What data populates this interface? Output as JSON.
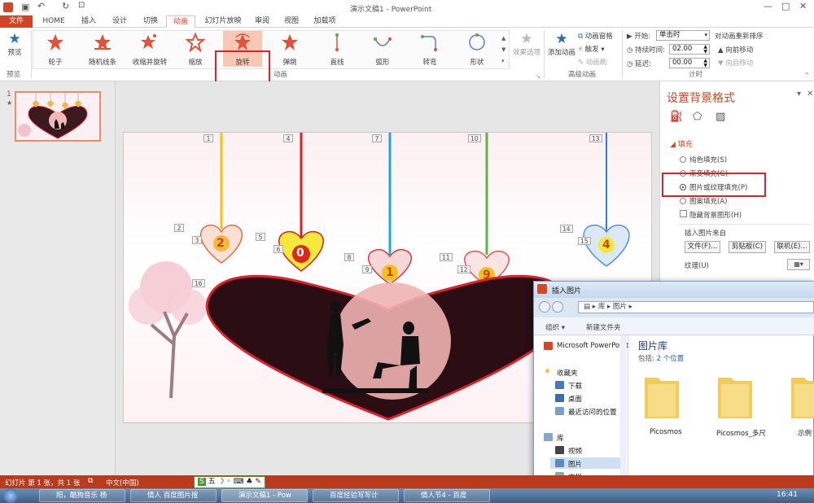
{
  "window_title": "演示文稿1 - PowerPoint",
  "tabs": [
    "文件",
    "HOME",
    "插入",
    "设计",
    "切换",
    "动画",
    "幻灯片放映",
    "审阅",
    "视图",
    "加载项"
  ],
  "ribbon": {
    "preview": {
      "label": "预览",
      "group": "预览"
    },
    "animations": [
      "轮子",
      "随机线条",
      "收缩并旋转",
      "缩放",
      "旋转",
      "弹跳",
      "直线",
      "弧形",
      "转弯",
      "形状"
    ],
    "selected_animation": "旋转",
    "effect_options": "效果选项",
    "group_animation": "动画",
    "add_animation": "添加动画",
    "animation_pane": "动画窗格",
    "trigger": "触发",
    "animation_painter": "动画刷",
    "group_advanced": "高级动画",
    "start_label": "开始:",
    "start_value": "单击时",
    "duration_label": "持续时间:",
    "duration_value": "02.00",
    "delay_label": "延迟:",
    "delay_value": "00.00",
    "reorder_title": "对动画重新排序",
    "move_earlier": "向前移动",
    "move_later": "向后移动",
    "group_timing": "计时"
  },
  "thumbnail": {
    "number": "1",
    "star": "★"
  },
  "slide": {
    "tags": [
      "1",
      "4",
      "7",
      "10",
      "13",
      "2",
      "3",
      "5",
      "6",
      "8",
      "9",
      "11",
      "12",
      "14",
      "15",
      "16"
    ],
    "hearts": [
      "2",
      "0",
      "1",
      "9",
      "4"
    ]
  },
  "format_pane": {
    "title": "设置背景格式",
    "section": "填充",
    "options": [
      "纯色填充(S)",
      "渐变填充(G)",
      "图片或纹理填充(P)",
      "图案填充(A)"
    ],
    "selected": "图片或纹理填充(P)",
    "hide_bg": "隐藏背景图形(H)",
    "insert_from": "插入图片来自",
    "file_btn": "文件(F)...",
    "clipboard_btn": "剪贴板(C)",
    "online_btn": "联机(E)...",
    "texture_label": "纹理(U)"
  },
  "dialog": {
    "title": "插入图片",
    "path": [
      "库",
      "图片"
    ],
    "organize": "组织",
    "new_folder": "新建文件夹",
    "nav": [
      "Microsoft PowerPoint",
      "收藏夹",
      "下载",
      "桌面",
      "最近访问的位置",
      "库",
      "视频",
      "图片",
      "文档"
    ],
    "library_title": "图片库",
    "library_sub": "包括: ",
    "library_link": "2 个位置",
    "folders": [
      "Picosmos",
      "Picosmos_多尺",
      "示例"
    ]
  },
  "status": {
    "slide_info": "幻灯片 第 1 张，共 1 张",
    "language": "中文(中国)",
    "ime": "五"
  },
  "taskbar": {
    "items": [
      "阳，酷狗音乐 杨",
      "情人 百度图片搜",
      "演示文稿1 - Pow",
      "百度经验写写计",
      "情人节4 - 百度"
    ],
    "time": "16:41"
  },
  "colors": {
    "accent": "#d04423",
    "highlight_box": "#e0202a",
    "statusbar": "#b83b1e"
  }
}
